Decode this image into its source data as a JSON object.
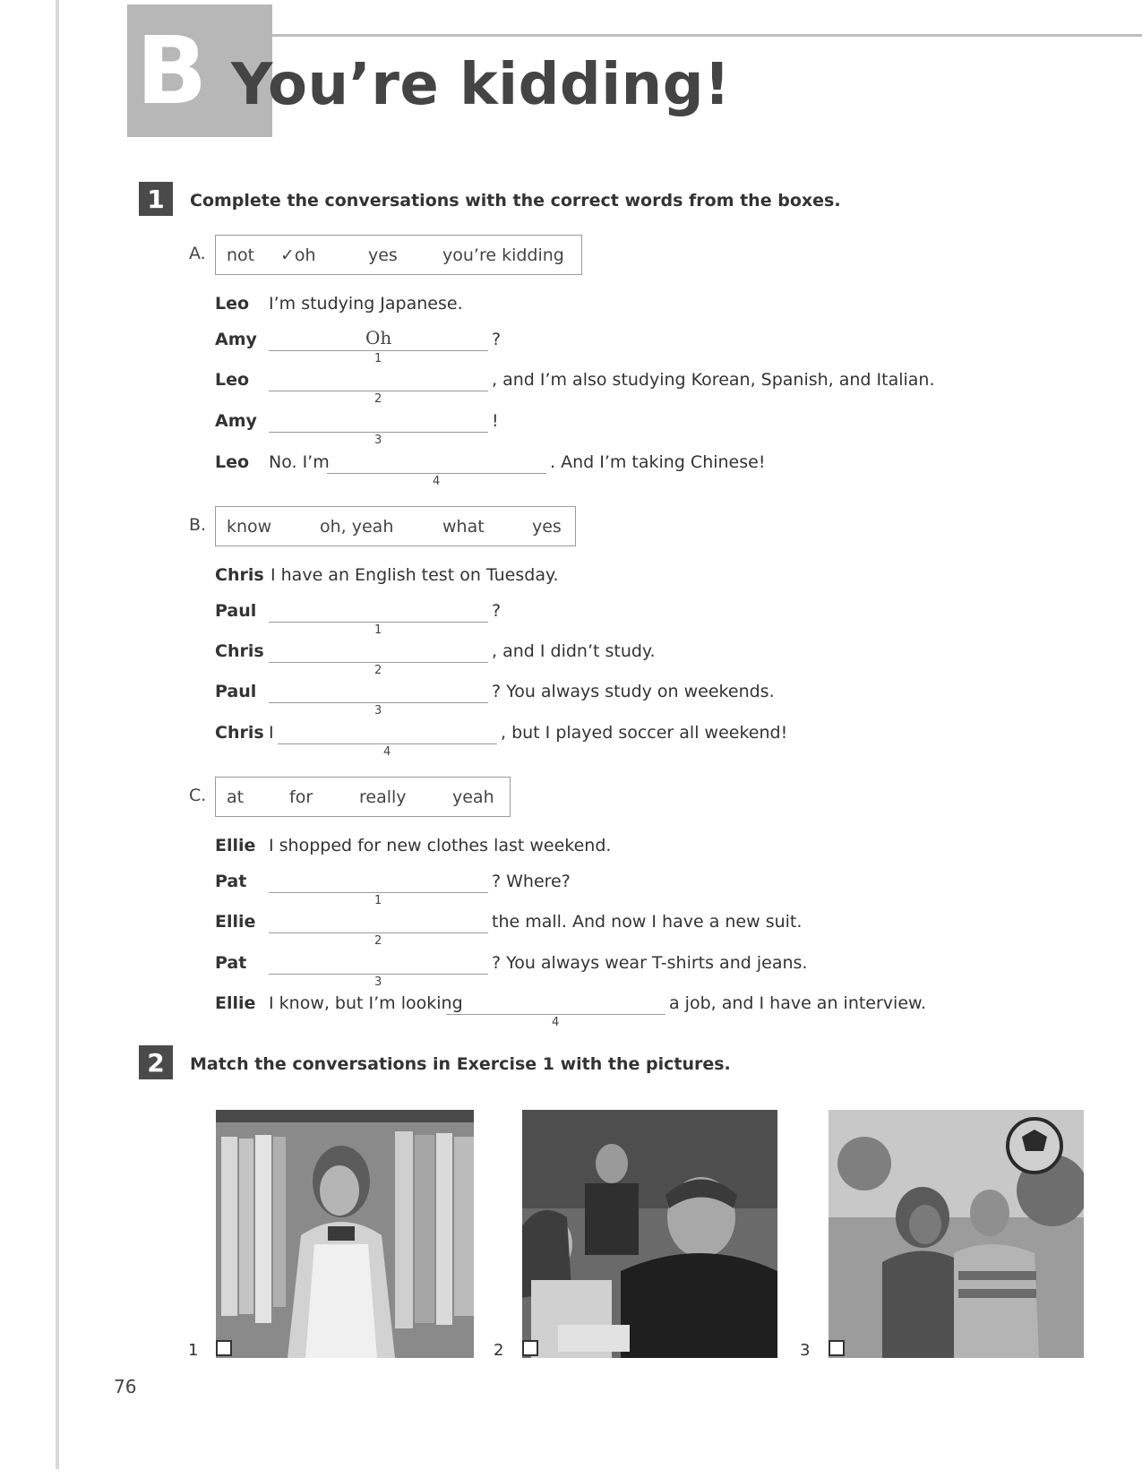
{
  "header": {
    "section_letter": "B",
    "title": "You’re kidding!"
  },
  "exercise1": {
    "number": "1",
    "instruction": "Complete the conversations with the correct words from the boxes.",
    "sections": [
      {
        "letter": "A.",
        "box_words": [
          "not",
          "✓oh",
          "yes",
          "you’re kidding"
        ],
        "lines": [
          {
            "speaker": "Leo",
            "before": "I’m studying Japanese.",
            "blank_num": "",
            "answer": "",
            "after": ""
          },
          {
            "speaker": "Amy",
            "before": "",
            "blank_num": "1",
            "answer": "Oh",
            "after": "?"
          },
          {
            "speaker": "Leo",
            "before": "",
            "blank_num": "2",
            "answer": "",
            "after": ", and I’m also studying Korean, Spanish, and Italian."
          },
          {
            "speaker": "Amy",
            "before": "",
            "blank_num": "3",
            "answer": "",
            "after": "!"
          },
          {
            "speaker": "Leo",
            "before": "No. I’m",
            "blank_num": "4",
            "answer": "",
            "after": ". And I’m taking Chinese!"
          }
        ]
      },
      {
        "letter": "B.",
        "box_words": [
          "know",
          "oh, yeah",
          "what",
          "yes"
        ],
        "lines": [
          {
            "speaker": "Chris",
            "before": "I have an English test on Tuesday.",
            "blank_num": "",
            "answer": "",
            "after": ""
          },
          {
            "speaker": "Paul",
            "before": "",
            "blank_num": "1",
            "answer": "",
            "after": "?"
          },
          {
            "speaker": "Chris",
            "before": "",
            "blank_num": "2",
            "answer": "",
            "after": ", and I didn’t study."
          },
          {
            "speaker": "Paul",
            "before": "",
            "blank_num": "3",
            "answer": "",
            "after": "? You always study on weekends."
          },
          {
            "speaker": "Chris",
            "before": "I",
            "blank_num": "4",
            "answer": "",
            "after": ", but I played soccer all weekend!"
          }
        ]
      },
      {
        "letter": "C.",
        "box_words": [
          "at",
          "for",
          "really",
          "yeah"
        ],
        "lines": [
          {
            "speaker": "Ellie",
            "before": "I shopped for new clothes last weekend.",
            "blank_num": "",
            "answer": "",
            "after": ""
          },
          {
            "speaker": "Pat",
            "before": "",
            "blank_num": "1",
            "answer": "",
            "after": "? Where?"
          },
          {
            "speaker": "Ellie",
            "before": "",
            "blank_num": "2",
            "answer": "",
            "after": "the mall. And now I have a new suit."
          },
          {
            "speaker": "Pat",
            "before": "",
            "blank_num": "3",
            "answer": "",
            "after": "? You always wear T-shirts and jeans."
          },
          {
            "speaker": "Ellie",
            "before": "I know, but I’m looking",
            "blank_num": "4",
            "answer": "",
            "after": "a job, and I have an interview."
          }
        ]
      }
    ]
  },
  "exercise2": {
    "number": "2",
    "instruction": "Match the conversations in Exercise 1 with the pictures.",
    "pictures": [
      {
        "number": "1",
        "icon": "photo-woman-shopping-clothes"
      },
      {
        "number": "2",
        "icon": "photo-students-in-class"
      },
      {
        "number": "3",
        "icon": "photo-friends-playing-soccer"
      }
    ]
  },
  "page_number": "76"
}
